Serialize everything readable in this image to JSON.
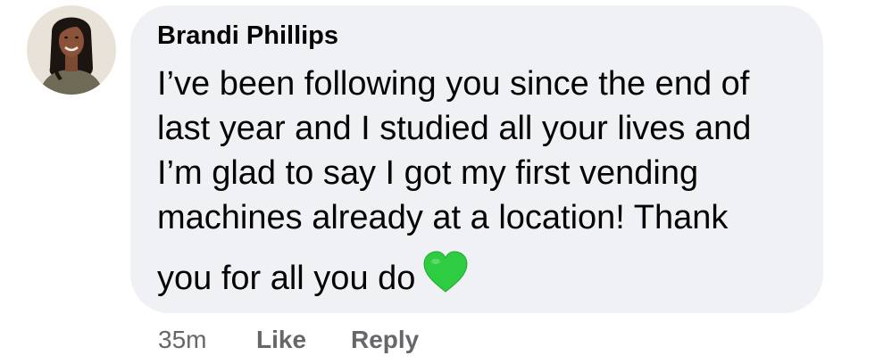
{
  "comment": {
    "author": "Brandi Phillips",
    "lines": [
      "I’ve been following you since the end of",
      "last year and I studied all your lives and",
      "I’m glad to say I got my first vending",
      "machines already at a location! Thank",
      "you for all you do"
    ],
    "emoji": "green-heart",
    "bubble_color": "#f0f1f5",
    "heart_color": "#2ecc40"
  },
  "actions": {
    "time": "35m",
    "like_label": "Like",
    "reply_label": "Reply"
  }
}
